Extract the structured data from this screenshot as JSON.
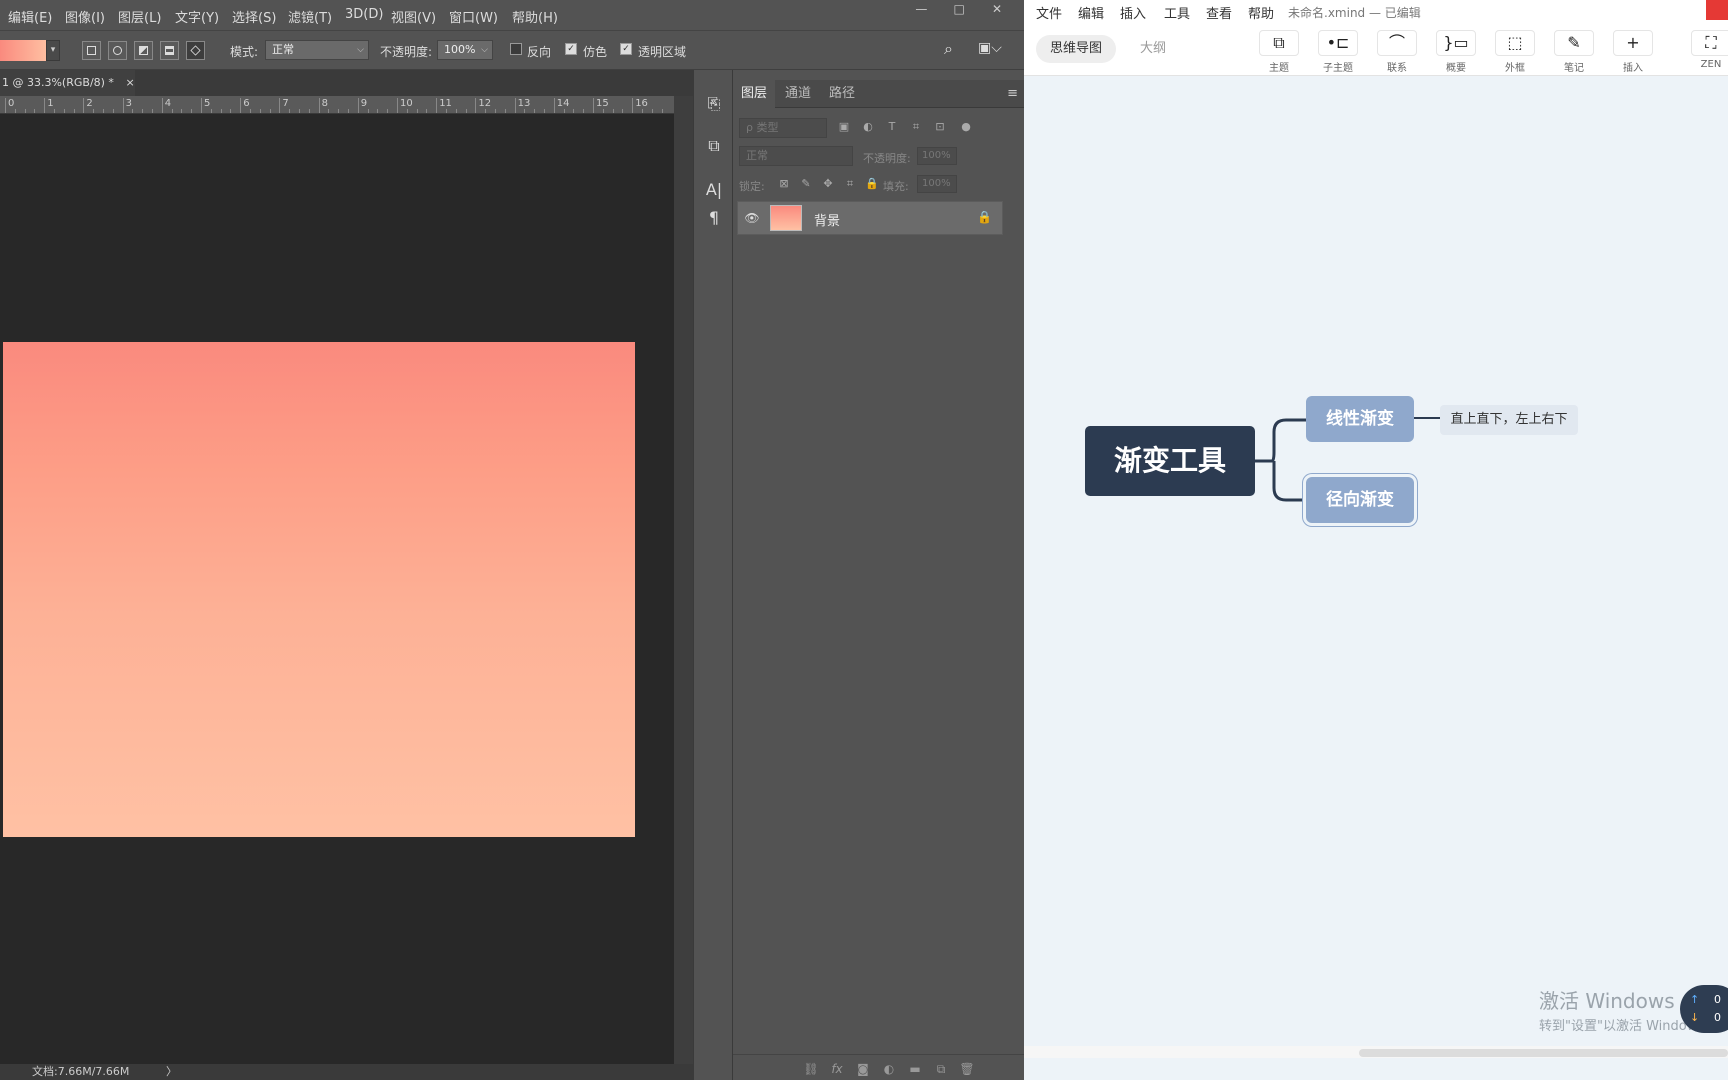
{
  "photoshop": {
    "menu": [
      "编辑(E)",
      "图像(I)",
      "图层(L)",
      "文字(Y)",
      "选择(S)",
      "滤镜(T)",
      "3D(D)",
      "视图(V)",
      "窗口(W)",
      "帮助(H)"
    ],
    "window_controls": [
      "—",
      "□",
      "✕"
    ],
    "options": {
      "mode_label": "模式:",
      "mode_value": "正常",
      "opacity_label": "不透明度:",
      "opacity_value": "100%",
      "reverse_label": "反向",
      "dither_label": "仿色",
      "transparency_label": "透明区域",
      "reverse_checked": false,
      "dither_checked": true,
      "transparency_checked": true
    },
    "document_tab": "1 @ 33.3%(RGB/8) *",
    "document_tab_close": "×",
    "ruler_ticks": [
      "0",
      "1",
      "2",
      "3",
      "4",
      "5",
      "6",
      "7",
      "8",
      "9",
      "10",
      "11",
      "12",
      "13",
      "14",
      "15",
      "16"
    ],
    "status": "文档:7.66M/7.66M",
    "status_arrow": "〉",
    "gradient_colors": [
      "#fa8a7e",
      "#ffc1a4"
    ],
    "layers_panel": {
      "tabs": [
        "图层",
        "通道",
        "路径"
      ],
      "filter_placeholder": "ρ 类型",
      "blend_mode": "正常",
      "opacity_label": "不透明度:",
      "opacity_value": "100%",
      "lock_label": "锁定:",
      "fill_label": "填充:",
      "fill_value": "100%",
      "layers": [
        {
          "name": "背景",
          "locked": true,
          "visible": true
        }
      ]
    }
  },
  "xmind": {
    "menu": [
      "文件",
      "编辑",
      "插入",
      "工具",
      "查看",
      "帮助"
    ],
    "file_status": "未命名.xmind — 已编辑",
    "modes": [
      "思维导图",
      "大纲"
    ],
    "toolbar": [
      {
        "icon": "topic-icon",
        "glyph": "⧉",
        "label": "主题"
      },
      {
        "icon": "subtopic-icon",
        "glyph": "•⊏",
        "label": "子主题"
      },
      {
        "icon": "relationship-icon",
        "glyph": "⌒",
        "label": "联系"
      },
      {
        "icon": "summary-icon",
        "glyph": "}▭",
        "label": "概要"
      },
      {
        "icon": "boundary-icon",
        "glyph": "⬚",
        "label": "外框"
      },
      {
        "icon": "note-icon",
        "glyph": "✎",
        "label": "笔记"
      },
      {
        "icon": "insert-icon",
        "glyph": "+",
        "label": "插入"
      },
      {
        "icon": "zen-icon",
        "glyph": "⛶",
        "label": "ZEN"
      }
    ],
    "map": {
      "root": "渐变工具",
      "branches": [
        {
          "label": "线性渐变",
          "note": "直上直下，左上右下"
        },
        {
          "label": "径向渐变",
          "note": ""
        }
      ],
      "root_color": "#2c3b51",
      "branch_color": "#8fa8cc"
    },
    "watermark": "激活 Windows",
    "watermark_sub": "转到\"设置\"以激活 Windows",
    "badge_values": [
      "0",
      "0"
    ]
  }
}
